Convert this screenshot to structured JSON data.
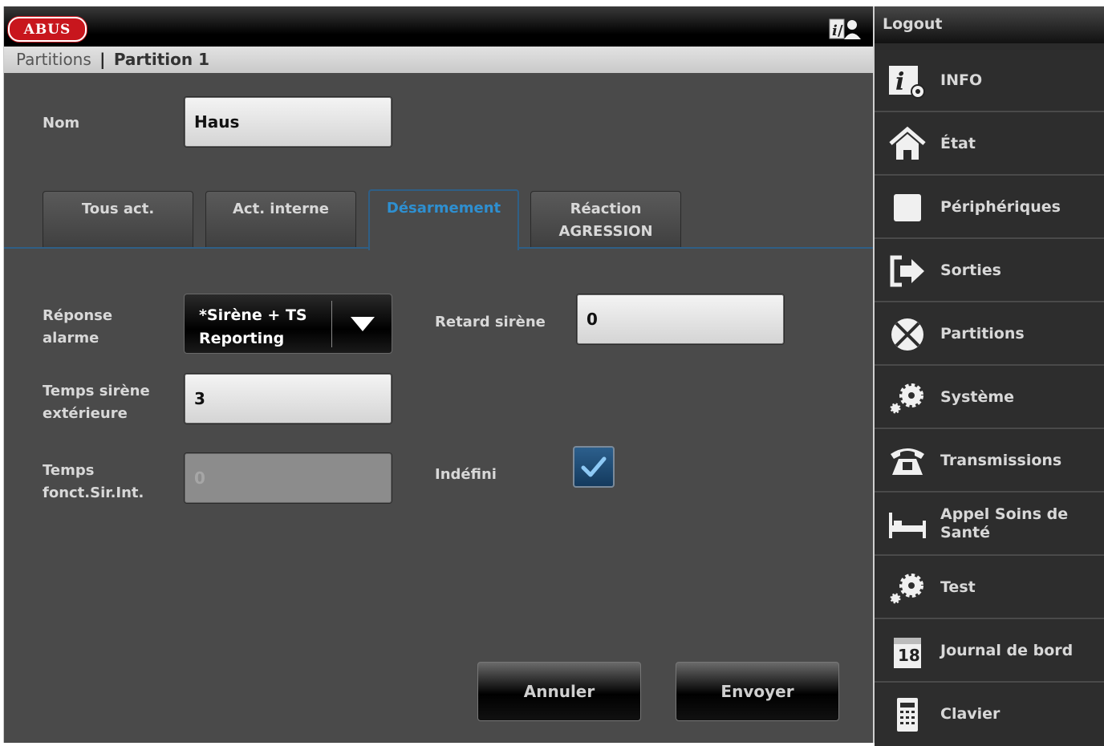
{
  "header": {
    "logo_text": "ABUS",
    "breadcrumb_root": "Partitions",
    "breadcrumb_separator": "|",
    "breadcrumb_current": "Partition 1"
  },
  "form": {
    "name_label": "Nom",
    "name_value": "Haus",
    "alarm_response_label": "Réponse alarme",
    "alarm_response_value": "*Sirène + TS Reporting",
    "siren_delay_label": "Retard sirène",
    "siren_delay_value": "0",
    "ext_siren_time_label": "Temps sirène extérieure",
    "ext_siren_time_value": "3",
    "int_siren_time_label": "Temps fonct.Sir.Int.",
    "int_siren_time_value": "0",
    "undefined_label": "Indéfini",
    "undefined_checked": true
  },
  "tabs": [
    {
      "label": "Tous act.",
      "active": false
    },
    {
      "label": "Act. interne",
      "active": false
    },
    {
      "label": "Désarmement",
      "active": true
    },
    {
      "label": "Réaction AGRESSION",
      "active": false
    }
  ],
  "buttons": {
    "cancel_label": "Annuler",
    "send_label": "Envoyer"
  },
  "sidebar": {
    "logout_label": "Logout",
    "items": [
      {
        "label": "INFO",
        "icon": "info-gear-icon"
      },
      {
        "label": "État",
        "icon": "house-icon"
      },
      {
        "label": "Périphériques",
        "icon": "device-square-icon"
      },
      {
        "label": "Sorties",
        "icon": "exit-arrow-icon"
      },
      {
        "label": "Partitions",
        "icon": "partitions-circle-icon"
      },
      {
        "label": "Système",
        "icon": "gears-icon"
      },
      {
        "label": "Transmissions",
        "icon": "telephone-icon"
      },
      {
        "label": "Appel Soins de Santé",
        "icon": "bed-icon"
      },
      {
        "label": "Test",
        "icon": "gears-icon"
      },
      {
        "label": "Journal de bord",
        "icon": "calendar-icon"
      },
      {
        "label": "Clavier",
        "icon": "keypad-icon"
      }
    ],
    "calendar_day": "18"
  },
  "colors": {
    "brand_red": "#c8161d",
    "active_tab_blue": "#2e8fd0",
    "panel_bg": "#4a4a4a",
    "sidebar_bg": "#2d2d2d"
  }
}
